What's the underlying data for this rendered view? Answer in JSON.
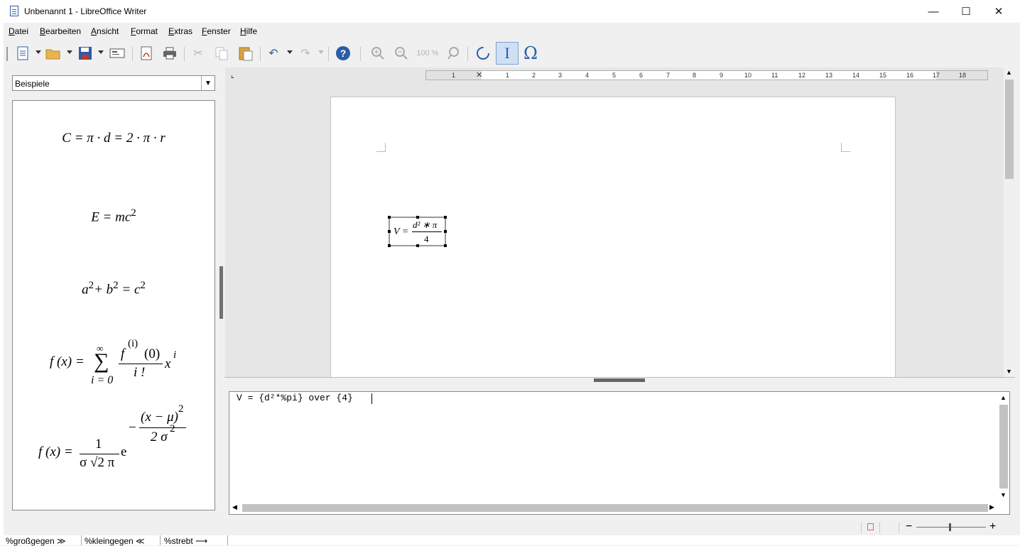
{
  "window": {
    "title": "Unbenannt 1 - LibreOffice Writer",
    "minimize": "—",
    "maximize": "☐",
    "close": "✕"
  },
  "menu": [
    "Datei",
    "Bearbeiten",
    "Ansicht",
    "Format",
    "Extras",
    "Fenster",
    "Hilfe"
  ],
  "toolbar": {
    "icons": [
      "new-document-icon",
      "open-icon",
      "save-icon",
      "email-icon",
      "export-pdf-icon",
      "print-icon",
      "cut-icon",
      "copy-icon",
      "paste-icon",
      "undo-icon",
      "redo-icon",
      "help-icon",
      "zoom-in-icon",
      "zoom-out-icon",
      "zoom-100-icon",
      "zoom-fit-icon",
      "update-icon",
      "formula-cursor-icon",
      "symbols-icon"
    ],
    "zoom_label": "100 %",
    "symbols_glyph": "Ω",
    "help_glyph": "?"
  },
  "elements": {
    "category": "Beispiele",
    "examples": {
      "circle": "C = π · d = 2 · π · r",
      "energy": "E = mc",
      "energy_exp": "2",
      "pythagoras_a": "a",
      "pythagoras_b": "+ b",
      "pythagoras_c": "= c",
      "exp2": "2",
      "taylor_lhs": "f (x) =",
      "taylor_sum": "∑",
      "taylor_inf": "∞",
      "taylor_from": "i = 0",
      "taylor_num": "f",
      "taylor_num_exp": "(i)",
      "taylor_num_arg": "(0)",
      "taylor_den": "i !",
      "taylor_x": "x",
      "taylor_x_exp": "i",
      "gauss_lhs": "f (x) =",
      "gauss_num": "1",
      "gauss_den": "σ √2 π",
      "gauss_e": "e",
      "gauss_minus": "−",
      "gauss_exp_num": "(x − μ)",
      "gauss_exp_den": "2 σ"
    }
  },
  "ruler": {
    "marks": [
      "1",
      "1",
      "2",
      "3",
      "4",
      "5",
      "6",
      "7",
      "8",
      "9",
      "10",
      "11",
      "12",
      "13",
      "14",
      "15",
      "16",
      "17",
      "18"
    ]
  },
  "document": {
    "formula_lhs": "V =",
    "formula_num": "d² ∗ π",
    "formula_den": "4"
  },
  "command": {
    "text": "V = {d²*%pi} over {4}"
  },
  "status": {
    "zoom_minus": "−",
    "zoom_plus": "+"
  },
  "bottom_strip": [
    "%großgegen ≫",
    "%kleingegen ≪",
    "%strebt ⟶"
  ]
}
